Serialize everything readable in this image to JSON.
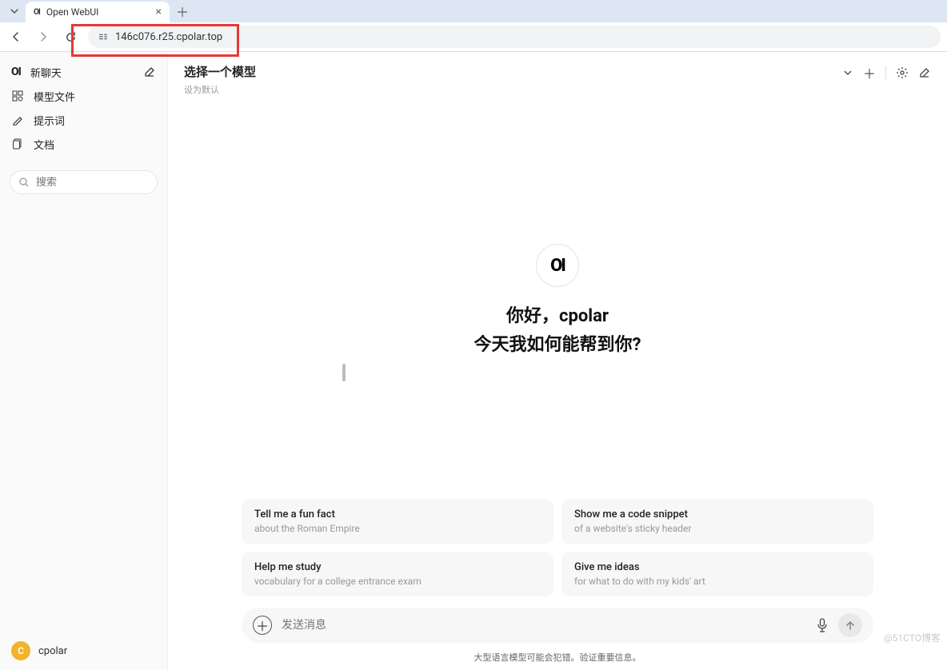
{
  "browser": {
    "tab_title": "Open WebUI",
    "url": "146c076.r25.cpolar.top"
  },
  "sidebar": {
    "logo": "OI",
    "new_chat": "新聊天",
    "items": [
      {
        "label": "模型文件"
      },
      {
        "label": "提示词"
      },
      {
        "label": "文档"
      }
    ],
    "search_placeholder": "搜索"
  },
  "header": {
    "model_title": "选择一个模型",
    "model_sub": "设为默认"
  },
  "center": {
    "logo": "OI",
    "greeting_line1": "你好，cpolar",
    "greeting_line2": "今天我如何能帮到你?"
  },
  "suggestions": [
    {
      "title": "Tell me a fun fact",
      "sub": "about the Roman Empire"
    },
    {
      "title": "Show me a code snippet",
      "sub": "of a website's sticky header"
    },
    {
      "title": "Help me study",
      "sub": "vocabulary for a college entrance exam"
    },
    {
      "title": "Give me ideas",
      "sub": "for what to do with my kids' art"
    }
  ],
  "input": {
    "placeholder": "发送消息"
  },
  "footer_note": "大型语言模型可能会犯错。验证重要信息。",
  "user": {
    "avatar_letter": "C",
    "name": "cpolar"
  },
  "watermark": "@51CTO博客"
}
